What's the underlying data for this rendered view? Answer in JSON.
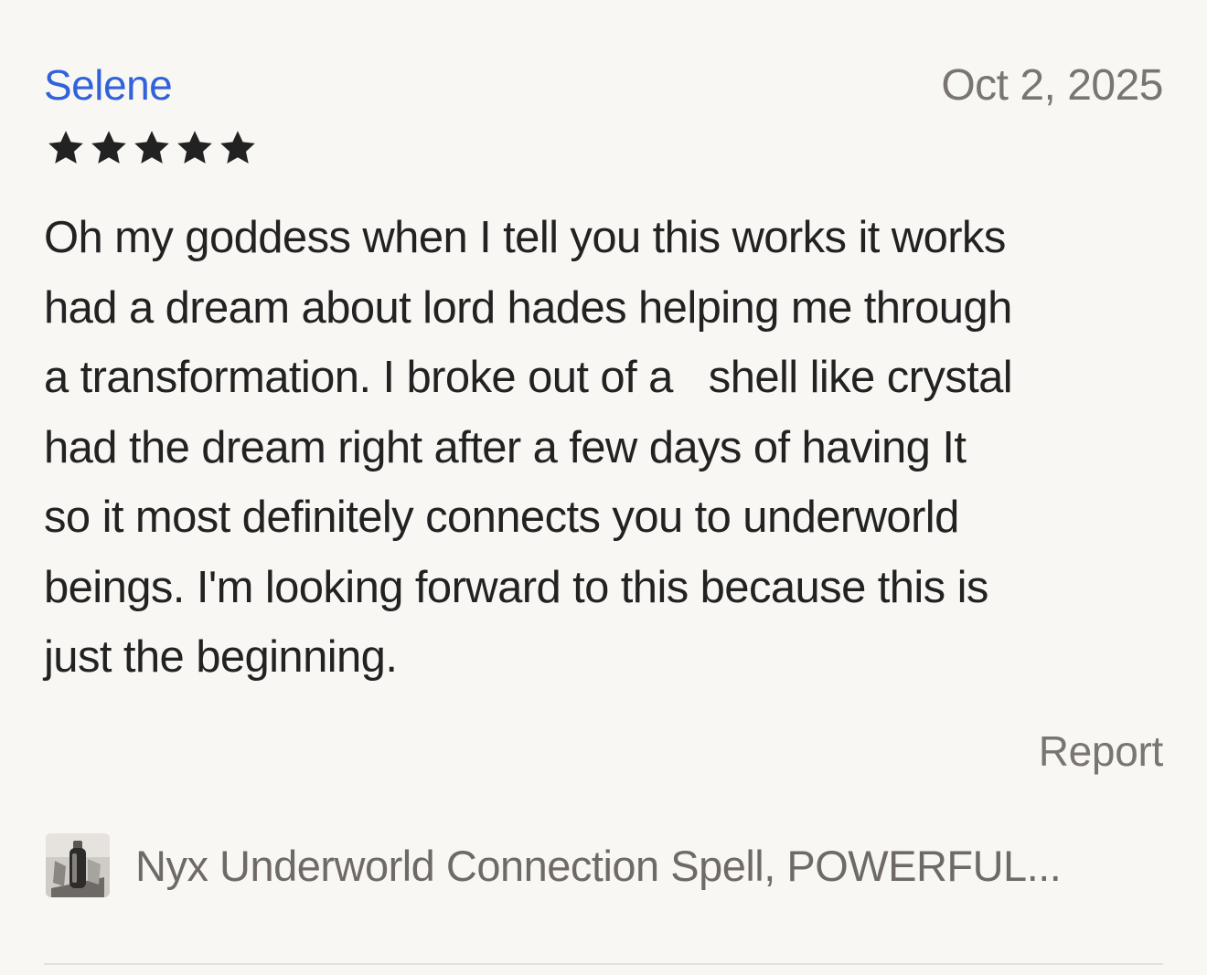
{
  "review": {
    "reviewer_name": "Selene",
    "date": "Oct 2, 2025",
    "rating": 5,
    "rating_max": 5,
    "star_color": "#222222",
    "text_lines": [
      "Oh my goddess when I tell you this works it works",
      "had a dream about lord hades helping me through",
      "a transformation. I broke out of a   shell like crystal",
      "had the dream right after a few days of having It",
      "so it most definitely connects you to underworld",
      "beings. I'm looking forward to this because this is",
      "just the beginning."
    ],
    "report_label": "Report"
  },
  "listing": {
    "title": "Nyx Underworld Connection Spell, POWERFUL..."
  },
  "colors": {
    "background": "#f8f7f4",
    "name_link": "#3162d9",
    "muted_text": "#7a7570",
    "body_text": "#222222",
    "divider": "#e4e1dc"
  }
}
